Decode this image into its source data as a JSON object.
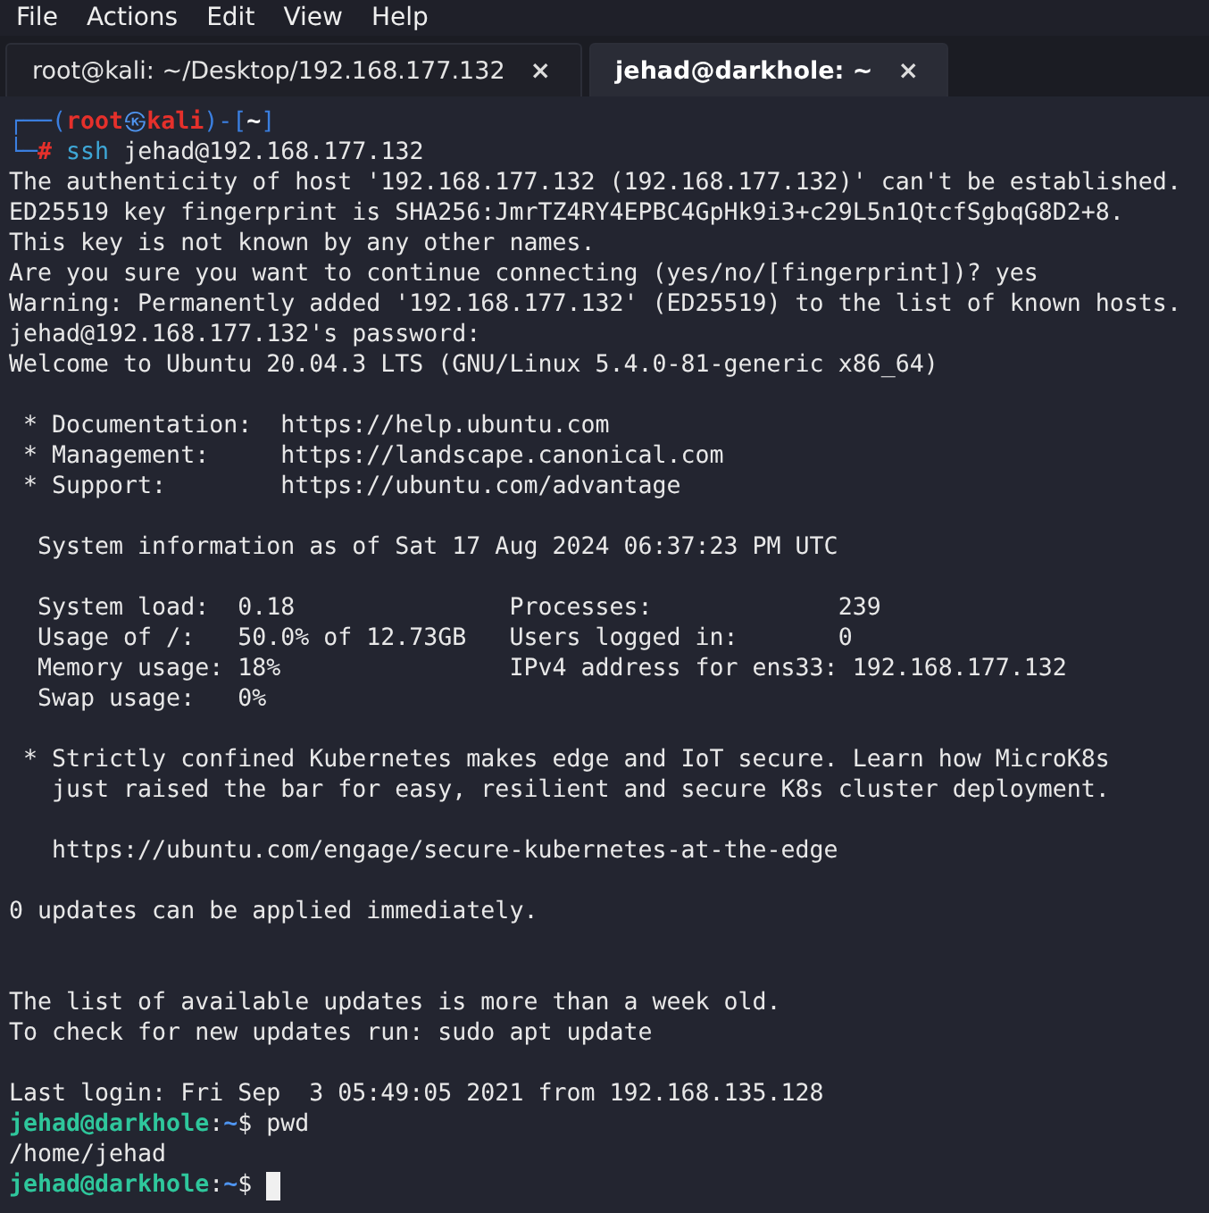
{
  "menu": [
    "File",
    "Actions",
    "Edit",
    "View",
    "Help"
  ],
  "tabs": [
    {
      "label": "root@kali: ~/Desktop/192.168.177.132",
      "close": "×",
      "selected": false
    },
    {
      "label": "jehad@darkhole: ~",
      "close": "×",
      "selected": true
    }
  ],
  "terminal": {
    "lines": [
      {
        "kind": "kali-top",
        "corner": "┌──(",
        "user": "root",
        "at": "㉿",
        "host": "kali",
        "close": ")-[",
        "dir": "~",
        "end": "]"
      },
      {
        "kind": "kali-cmd",
        "corner": "└─",
        "sigil": "#",
        "command": "ssh",
        "args": "jehad@192.168.177.132"
      },
      {
        "kind": "text",
        "text": "The authenticity of host '192.168.177.132 (192.168.177.132)' can't be established."
      },
      {
        "kind": "text",
        "text": "ED25519 key fingerprint is SHA256:JmrTZ4RY4EPBC4GpHk9i3+c29L5n1QtcfSgbqG8D2+8."
      },
      {
        "kind": "text",
        "text": "This key is not known by any other names."
      },
      {
        "kind": "text",
        "text": "Are you sure you want to continue connecting (yes/no/[fingerprint])? yes"
      },
      {
        "kind": "text",
        "text": "Warning: Permanently added '192.168.177.132' (ED25519) to the list of known hosts."
      },
      {
        "kind": "text",
        "text": "jehad@192.168.177.132's password:"
      },
      {
        "kind": "text",
        "text": "Welcome to Ubuntu 20.04.3 LTS (GNU/Linux 5.4.0-81-generic x86_64)"
      },
      {
        "kind": "blank"
      },
      {
        "kind": "text",
        "text": " * Documentation:  https://help.ubuntu.com"
      },
      {
        "kind": "text",
        "text": " * Management:     https://landscape.canonical.com"
      },
      {
        "kind": "text",
        "text": " * Support:        https://ubuntu.com/advantage"
      },
      {
        "kind": "blank"
      },
      {
        "kind": "text",
        "text": "  System information as of Sat 17 Aug 2024 06:37:23 PM UTC"
      },
      {
        "kind": "blank"
      },
      {
        "kind": "text",
        "text": "  System load:  0.18               Processes:             239"
      },
      {
        "kind": "text",
        "text": "  Usage of /:   50.0% of 12.73GB   Users logged in:       0"
      },
      {
        "kind": "text",
        "text": "  Memory usage: 18%                IPv4 address for ens33: 192.168.177.132"
      },
      {
        "kind": "text",
        "text": "  Swap usage:   0%"
      },
      {
        "kind": "blank"
      },
      {
        "kind": "text",
        "text": " * Strictly confined Kubernetes makes edge and IoT secure. Learn how MicroK8s"
      },
      {
        "kind": "text",
        "text": "   just raised the bar for easy, resilient and secure K8s cluster deployment."
      },
      {
        "kind": "blank"
      },
      {
        "kind": "text",
        "text": "   https://ubuntu.com/engage/secure-kubernetes-at-the-edge"
      },
      {
        "kind": "blank"
      },
      {
        "kind": "text",
        "text": "0 updates can be applied immediately."
      },
      {
        "kind": "blank"
      },
      {
        "kind": "blank"
      },
      {
        "kind": "text",
        "text": "The list of available updates is more than a week old."
      },
      {
        "kind": "text",
        "text": "To check for new updates run: sudo apt update"
      },
      {
        "kind": "blank"
      },
      {
        "kind": "text",
        "text": "Last login: Fri Sep  3 05:49:05 2021 from 192.168.135.128"
      },
      {
        "kind": "user-prompt",
        "user": "jehad@darkhole",
        "colon": ":",
        "dir": "~",
        "sigil": "$",
        "command": "pwd"
      },
      {
        "kind": "text",
        "text": "/home/jehad"
      },
      {
        "kind": "user-prompt",
        "user": "jehad@darkhole",
        "colon": ":",
        "dir": "~",
        "sigil": "$"
      }
    ]
  }
}
